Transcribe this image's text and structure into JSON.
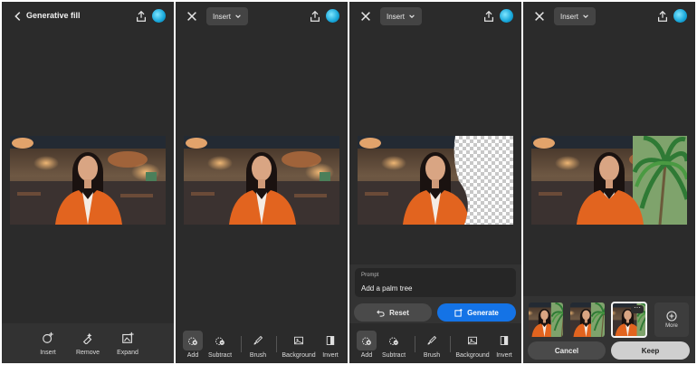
{
  "screen1": {
    "title": "Generative fill",
    "tools": [
      {
        "label": "Insert",
        "icon": "insert-icon"
      },
      {
        "label": "Remove",
        "icon": "remove-icon"
      },
      {
        "label": "Expand",
        "icon": "expand-icon"
      }
    ]
  },
  "insert_dropdown": {
    "label": "Insert"
  },
  "selection_tools": [
    {
      "label": "Add",
      "icon": "add-selection-icon",
      "active": true
    },
    {
      "label": "Subtract",
      "icon": "subtract-selection-icon"
    },
    {
      "label": "Brush",
      "icon": "brush-icon"
    },
    {
      "label": "Background",
      "icon": "background-icon"
    },
    {
      "label": "Invert",
      "icon": "invert-icon"
    }
  ],
  "screen3": {
    "prompt_label": "Prompt",
    "prompt_value": "Add a palm tree",
    "reset_label": "Reset",
    "generate_label": "Generate"
  },
  "screen4": {
    "more_label": "More",
    "cancel_label": "Cancel",
    "keep_label": "Keep",
    "selected_variation": 3
  },
  "colors": {
    "background": "#2b2b2b",
    "panel": "#333333",
    "accent": "#1473e6",
    "avatar": "#16a5d8"
  }
}
